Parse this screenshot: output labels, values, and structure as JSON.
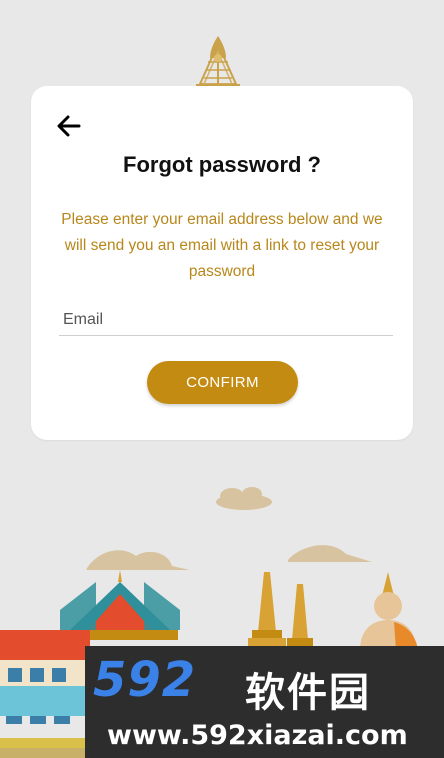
{
  "header": {
    "emblem_icon": "royal-emblem-icon"
  },
  "card": {
    "back_icon": "arrow-left-icon",
    "title": "Forgot password ?",
    "description": "Please enter your email address below and we will send you an email with a link to reset your password",
    "email": {
      "placeholder": "Email",
      "value": ""
    },
    "confirm_label": "CONFIRM"
  },
  "watermark": {
    "logo_text": "592",
    "cn_text": "软件园",
    "url_text": "www.592xiazai.com"
  },
  "colors": {
    "background": "#e8e8e8",
    "accent": "#c48b12",
    "description_text": "#b8871b",
    "title_text": "#111111"
  }
}
